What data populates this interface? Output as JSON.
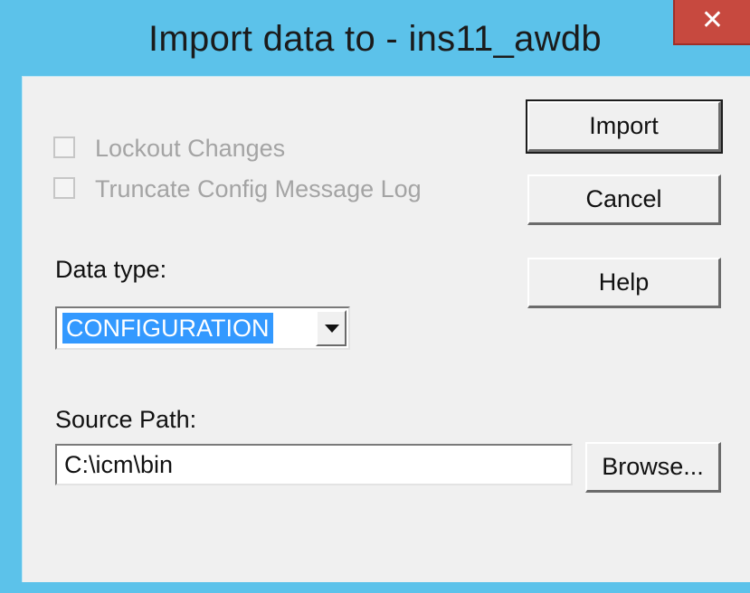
{
  "window": {
    "title": "Import data to - ins11_awdb",
    "close_glyph": "✕",
    "titlebar_color": "#5cc2ea",
    "close_color": "#c7493f"
  },
  "options": {
    "lockout_label": "Lockout Changes",
    "lockout_checked": false,
    "lockout_enabled": false,
    "truncate_label": "Truncate Config Message Log",
    "truncate_checked": false,
    "truncate_enabled": false
  },
  "data_type": {
    "label": "Data type:",
    "selected": "CONFIGURATION",
    "selection_color": "#3399ff"
  },
  "source_path": {
    "label": "Source Path:",
    "value": "C:\\icm\\bin",
    "browse_label": "Browse..."
  },
  "buttons": {
    "import_label": "Import",
    "cancel_label": "Cancel",
    "help_label": "Help"
  },
  "icons": {
    "close": "close-icon",
    "dropdown": "chevron-down-icon"
  }
}
